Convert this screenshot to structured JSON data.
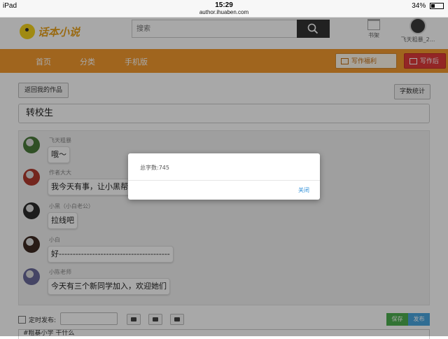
{
  "status_bar": {
    "device": "iPad",
    "time": "15:29",
    "url": "author.ihuaben.com",
    "battery": "34%"
  },
  "header": {
    "logo_text": "话本小说",
    "search_placeholder": "搜索",
    "bookshelf_label": "书架",
    "username": "飞天粗暴_2..."
  },
  "nav": {
    "items": [
      "首页",
      "分类",
      "手机版"
    ],
    "welfare_label": "写作福利",
    "backend_label": "写作后台"
  },
  "content": {
    "back_button": "返回我的作品",
    "count_button": "字数统计",
    "title": "转校生",
    "messages": [
      {
        "name": "飞天粗暴",
        "text": "哦～",
        "avatar_color": "#4a7a3a"
      },
      {
        "name": "作者大大",
        "text": "我今天有事，让小黑帮我写",
        "avatar_color": "#b03a2e"
      },
      {
        "name": "小黑（小白老公）",
        "text": "拉线吧",
        "avatar_color": "#2b2b2b"
      },
      {
        "name": "小白",
        "text": "好----------------------------------------",
        "avatar_color": "#3d2a22"
      },
      {
        "name": "小陈老师",
        "text": "今天有三个新同学加入，欢迎她们",
        "avatar_color": "#6a6a9a"
      }
    ],
    "schedule_label": "定时发布:",
    "save_label": "保存",
    "publish_label": "发布",
    "draft_text": "#粗暴小学 干什么"
  },
  "modal": {
    "text": "总字数:745",
    "close_label": "关闭"
  },
  "colors": {
    "nav_orange": "#f39a2e",
    "save_green": "#4caf50",
    "publish_blue": "#49a6e0",
    "backend_red": "#e03a3a",
    "link_blue": "#2f8fd8"
  }
}
